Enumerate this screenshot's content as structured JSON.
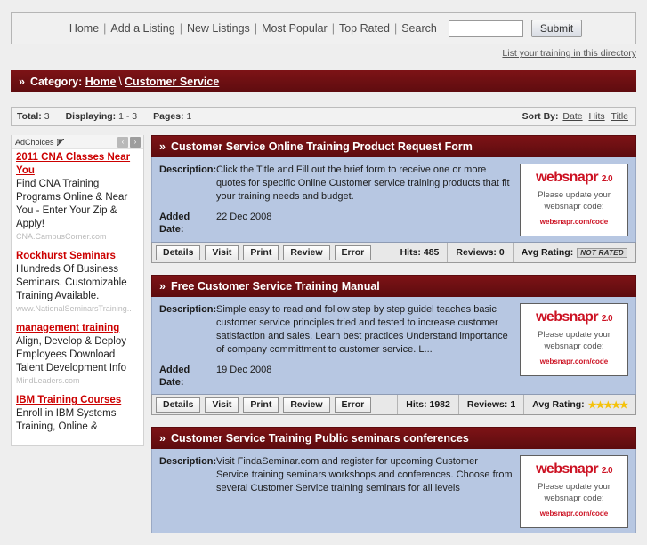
{
  "topnav": {
    "links": [
      "Home",
      "Add a Listing",
      "New Listings",
      "Most Popular",
      "Top Rated",
      "Search"
    ],
    "separator": "|",
    "search_value": "",
    "search_placeholder": "",
    "submit_label": "Submit"
  },
  "list_link": "List your training in this directory",
  "category": {
    "chevron": "»",
    "label": "Category:",
    "home": "Home",
    "slash": "\\",
    "current": "Customer Service"
  },
  "stats": {
    "total_label": "Total:",
    "total_value": "3",
    "displaying_label": "Displaying:",
    "displaying_value": "1 - 3",
    "pages_label": "Pages:",
    "pages_value": "1",
    "sort_label": "Sort By:",
    "sort_options": [
      "Date",
      "Hits",
      "Title"
    ]
  },
  "sidebar": {
    "adchoices_label": "AdChoices",
    "prev_arrow": "‹",
    "next_arrow": "›",
    "ads": [
      {
        "title": "2011 CNA Classes Near You",
        "desc": "Find CNA Training Programs Online & Near You - Enter Your Zip & Apply!",
        "url": "CNA.CampusCorner.com"
      },
      {
        "title": "Rockhurst Seminars",
        "desc": "Hundreds Of Business Seminars. Customizable Training Available.",
        "url": "www.NationalSeminarsTraining.."
      },
      {
        "title": "management training",
        "desc": "Align, Develop & Deploy Employees Download Talent Development Info",
        "url": "MindLeaders.com"
      },
      {
        "title": "IBM Training Courses",
        "desc": "Enroll in IBM Systems Training, Online &",
        "url": ""
      }
    ]
  },
  "websnapr": {
    "logo": "websnapr",
    "version": "2.0",
    "message_line1": "Please update your",
    "message_line2": "websnapr code:",
    "code_url": "websnapr.com/code"
  },
  "labels": {
    "description": "Description:",
    "added_date_line1": "Added",
    "added_date_line2": "Date:",
    "buttons": [
      "Details",
      "Visit",
      "Print",
      "Review",
      "Error"
    ],
    "hits_label": "Hits:",
    "reviews_label": "Reviews:",
    "rating_label": "Avg Rating:",
    "not_rated": "NOT RATED",
    "chevron": "»",
    "five_stars": "★★★★★"
  },
  "listings": [
    {
      "title": "Customer Service Online Training Product Request Form",
      "description": "Click the Title and Fill out the brief form to receive one or more quotes for specific Online Customer service training products that fit your training needs and budget.",
      "added_date": "22 Dec 2008",
      "hits": "485",
      "reviews": "0",
      "rating": "NOT RATED",
      "rated": false
    },
    {
      "title": "Free Customer Service Training Manual",
      "description": "Simple easy to read and follow step by step guidel teaches basic customer service principles tried and tested to increase customer satisfaction and sales. Learn best practices Understand importance of company committment to customer service. L...",
      "added_date": "19 Dec 2008",
      "hits": "1982",
      "reviews": "1",
      "rating": "★★★★★",
      "rated": true
    },
    {
      "title": "Customer Service Training Public seminars conferences",
      "description": "Visit FindaSeminar.com and register for upcoming Customer Service training seminars workshops and conferences. Choose from several Customer Service training seminars for all levels",
      "added_date": "",
      "hits": "",
      "reviews": "",
      "rating": "",
      "rated": false
    }
  ],
  "colors": {
    "maroon": "#741014",
    "panel_blue": "#b7c7e2",
    "ad_red": "#cc0000",
    "star_gold": "#f5c20a"
  }
}
